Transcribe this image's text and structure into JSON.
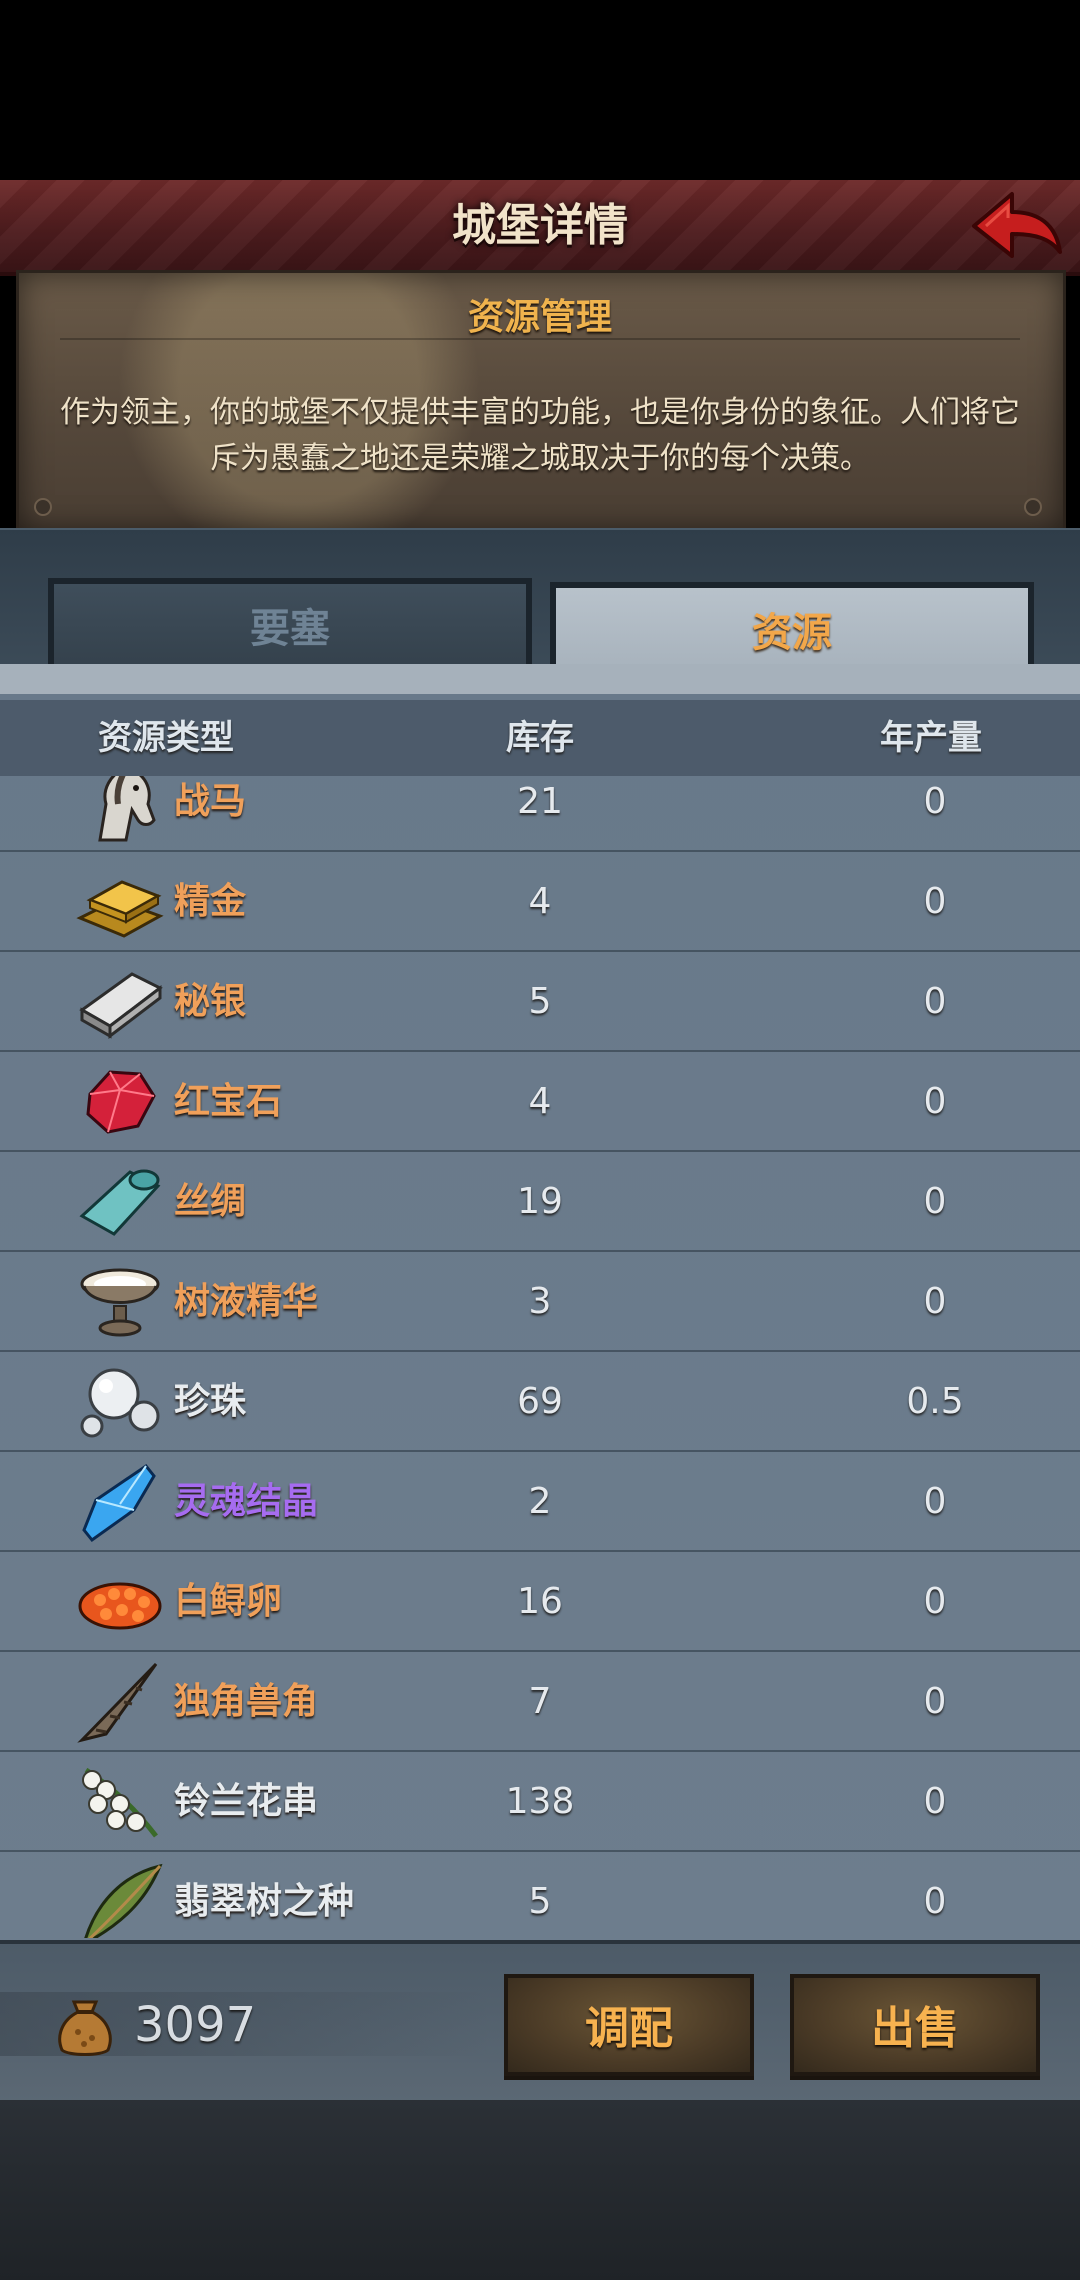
{
  "header": {
    "title": "城堡详情"
  },
  "intro": {
    "title": "资源管理",
    "description": "作为领主，你的城堡不仅提供丰富的功能，也是你身份的象征。人们将它斥为愚蠢之地还是荣耀之城取决于你的每个决策。"
  },
  "tabs": {
    "fortress_label": "要塞",
    "resource_label": "资源",
    "active": "资源"
  },
  "table": {
    "columns": {
      "type": "资源类型",
      "stock": "库存",
      "yearly": "年产量"
    },
    "rows": [
      {
        "name": "战马",
        "stock": "21",
        "yearly": "0",
        "icon": "horse-icon"
      },
      {
        "name": "精金",
        "stock": "4",
        "yearly": "0",
        "icon": "gold-bar-icon"
      },
      {
        "name": "秘银",
        "stock": "5",
        "yearly": "0",
        "icon": "silver-bar-icon"
      },
      {
        "name": "红宝石",
        "stock": "4",
        "yearly": "0",
        "icon": "ruby-icon"
      },
      {
        "name": "丝绸",
        "stock": "19",
        "yearly": "0",
        "icon": "silk-icon"
      },
      {
        "name": "树液精华",
        "stock": "3",
        "yearly": "0",
        "icon": "sap-bowl-icon"
      },
      {
        "name": "珍珠",
        "stock": "69",
        "yearly": "0.5",
        "icon": "pearl-icon"
      },
      {
        "name": "灵魂结晶",
        "stock": "2",
        "yearly": "0",
        "icon": "soul-crystal-icon"
      },
      {
        "name": "白鲟卵",
        "stock": "16",
        "yearly": "0",
        "icon": "caviar-icon"
      },
      {
        "name": "独角兽角",
        "stock": "7",
        "yearly": "0",
        "icon": "unicorn-horn-icon"
      },
      {
        "name": "铃兰花串",
        "stock": "138",
        "yearly": "0",
        "icon": "lily-of-the-valley-icon"
      },
      {
        "name": "翡翠树之种",
        "stock": "5",
        "yearly": "0",
        "icon": "emerald-seed-icon"
      }
    ]
  },
  "footer": {
    "gold": "3097",
    "allocate_label": "调配",
    "sell_label": "出售"
  },
  "colors": {
    "accent": "#f0a05a",
    "rare": "#a66cf0",
    "header": "#5a2224"
  }
}
